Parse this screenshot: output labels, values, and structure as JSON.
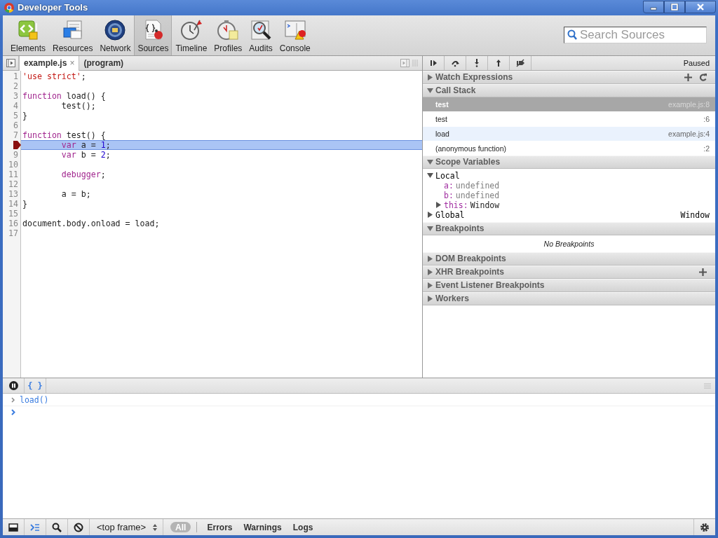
{
  "window": {
    "title": "Developer Tools"
  },
  "toolbar": {
    "tools": [
      {
        "label": "Elements",
        "selected": false
      },
      {
        "label": "Resources",
        "selected": false
      },
      {
        "label": "Network",
        "selected": false
      },
      {
        "label": "Sources",
        "selected": true
      },
      {
        "label": "Timeline",
        "selected": false
      },
      {
        "label": "Profiles",
        "selected": false
      },
      {
        "label": "Audits",
        "selected": false
      },
      {
        "label": "Console",
        "selected": false
      }
    ],
    "search": {
      "placeholder": "Search Sources"
    }
  },
  "editor": {
    "tabs": [
      {
        "label": "example.js",
        "selected": true,
        "close": "×"
      },
      {
        "label": "(program)",
        "selected": false
      }
    ],
    "lines": [
      {
        "number": "1",
        "current": false,
        "breakpoint": false,
        "tokens": [
          {
            "kind": "string",
            "text": "'use strict'"
          },
          {
            "kind": "plain",
            "text": ";"
          }
        ]
      },
      {
        "number": "2",
        "current": false,
        "breakpoint": false
      },
      {
        "number": "3",
        "current": false,
        "breakpoint": false,
        "tokens": [
          {
            "kind": "keyword",
            "text": "function"
          },
          {
            "kind": "plain",
            "text": " load() {"
          }
        ]
      },
      {
        "number": "4",
        "current": false,
        "breakpoint": false,
        "tokens": [
          {
            "kind": "plain",
            "text": "        test();"
          }
        ]
      },
      {
        "number": "5",
        "current": false,
        "breakpoint": false,
        "tokens": [
          {
            "kind": "plain",
            "text": "}"
          }
        ]
      },
      {
        "number": "6",
        "current": false,
        "breakpoint": false
      },
      {
        "number": "7",
        "current": false,
        "breakpoint": false,
        "tokens": [
          {
            "kind": "keyword",
            "text": "function"
          },
          {
            "kind": "plain",
            "text": " test() {"
          }
        ]
      },
      {
        "current": true,
        "breakpoint": true,
        "tokens": [
          {
            "kind": "keyword",
            "text": "        var"
          },
          {
            "kind": "plain",
            "text": " a = "
          },
          {
            "kind": "number",
            "text": "1"
          },
          {
            "kind": "plain",
            "text": ";"
          }
        ]
      },
      {
        "number": "9",
        "current": false,
        "breakpoint": false,
        "tokens": [
          {
            "kind": "keyword",
            "text": "        var"
          },
          {
            "kind": "plain",
            "text": " b = "
          },
          {
            "kind": "number",
            "text": "2"
          },
          {
            "kind": "plain",
            "text": ";"
          }
        ]
      },
      {
        "number": "10",
        "current": false,
        "breakpoint": false
      },
      {
        "number": "11",
        "current": false,
        "breakpoint": false,
        "tokens": [
          {
            "kind": "keyword",
            "text": "        debugger"
          },
          {
            "kind": "plain",
            "text": ";"
          }
        ]
      },
      {
        "number": "12",
        "current": false,
        "breakpoint": false
      },
      {
        "number": "13",
        "current": false,
        "breakpoint": false,
        "tokens": [
          {
            "kind": "plain",
            "text": "        a = b;"
          }
        ]
      },
      {
        "number": "14",
        "current": false,
        "breakpoint": false,
        "tokens": [
          {
            "kind": "plain",
            "text": "}"
          }
        ]
      },
      {
        "number": "15",
        "current": false,
        "breakpoint": false
      },
      {
        "number": "16",
        "current": false,
        "breakpoint": false,
        "tokens": [
          {
            "kind": "plain",
            "text": "document.body.onload = load;"
          }
        ]
      },
      {
        "number": "17",
        "current": false,
        "breakpoint": false
      }
    ]
  },
  "debugger": {
    "status": "Paused",
    "sections": [
      {
        "title": "Watch Expressions",
        "kind": "watch",
        "expanded": false
      },
      {
        "title": "Call Stack",
        "kind": "callstack",
        "expanded": true,
        "frames": [
          {
            "function": "test",
            "location": "example.js:8",
            "selected": true
          },
          {
            "function": "test",
            "location": ":6",
            "selected": false
          },
          {
            "function": "load",
            "location": "example.js:4",
            "selected": false
          },
          {
            "function": "(anonymous function)",
            "location": ":2",
            "selected": false
          }
        ]
      },
      {
        "title": "Scope Variables",
        "kind": "scope",
        "expanded": true,
        "scopes": [
          {
            "name": "Local",
            "expanded": true,
            "children": [
              {
                "name": "a:",
                "value": "undefined",
                "kind": "primitive"
              },
              {
                "name": "b:",
                "value": "undefined",
                "kind": "primitive"
              },
              {
                "name": "this:",
                "value": "Window",
                "kind": "object",
                "expanded": false
              }
            ]
          },
          {
            "name": "Global",
            "expanded": false,
            "value": "Window"
          }
        ]
      },
      {
        "title": "Breakpoints",
        "kind": "breakpoints",
        "expanded": true,
        "message": "No Breakpoints"
      },
      {
        "title": "DOM Breakpoints",
        "kind": "dom",
        "expanded": false
      },
      {
        "title": "XHR Breakpoints",
        "kind": "xhr",
        "expanded": false
      },
      {
        "title": "Event Listener Breakpoints",
        "kind": "events",
        "expanded": false
      },
      {
        "title": "Workers",
        "kind": "workers",
        "expanded": false
      }
    ]
  },
  "console": {
    "pretty_print": "{ }",
    "history": [
      {
        "input": "load()"
      }
    ]
  },
  "status_bar": {
    "frame": "<top frame>",
    "filters": [
      {
        "label": "All",
        "selected": true
      },
      {
        "label": "Errors",
        "selected": false
      },
      {
        "label": "Warnings",
        "selected": false
      },
      {
        "label": "Logs",
        "selected": false
      }
    ]
  }
}
